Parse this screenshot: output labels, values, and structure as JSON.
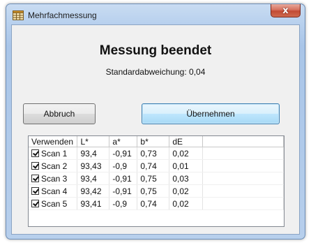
{
  "window": {
    "title": "Mehrfachmessung",
    "close_label": "x"
  },
  "heading": "Messung beendet",
  "stddev_label": "Standardabweichung:",
  "stddev_value": "0,04",
  "buttons": {
    "cancel": "Abbruch",
    "accept": "Übernehmen"
  },
  "table": {
    "headers": [
      "Verwenden",
      "L*",
      "a*",
      "b*",
      "dE"
    ],
    "rows": [
      {
        "use": true,
        "name": "Scan 1",
        "L": "93,4",
        "a": "-0,91",
        "b": "0,73",
        "dE": "0,02"
      },
      {
        "use": true,
        "name": "Scan 2",
        "L": "93,43",
        "a": "-0,9",
        "b": "0,74",
        "dE": "0,01"
      },
      {
        "use": true,
        "name": "Scan 3",
        "L": "93,4",
        "a": "-0,91",
        "b": "0,75",
        "dE": "0,03"
      },
      {
        "use": true,
        "name": "Scan 4",
        "L": "93,42",
        "a": "-0,91",
        "b": "0,75",
        "dE": "0,02"
      },
      {
        "use": true,
        "name": "Scan 5",
        "L": "93,41",
        "a": "-0,9",
        "b": "0,74",
        "dE": "0,02"
      }
    ]
  },
  "icons": {
    "app": "table-icon",
    "close": "close-icon",
    "checkbox": "checkbox-checked-icon"
  }
}
